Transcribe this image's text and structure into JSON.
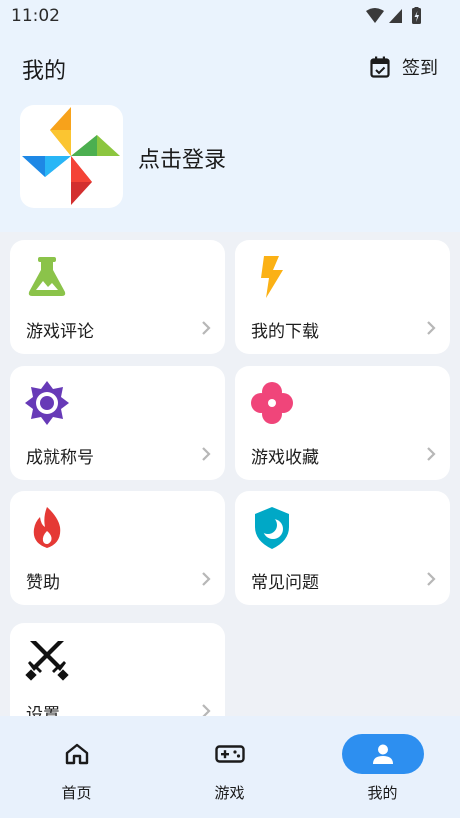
{
  "status_bar": {
    "time": "11:02"
  },
  "header": {
    "title": "我的",
    "checkin_label": "签到"
  },
  "profile": {
    "login_prompt": "点击登录"
  },
  "menu": {
    "game_reviews": "游戏评论",
    "my_downloads": "我的下载",
    "achievements": "成就称号",
    "game_favorites": "游戏收藏",
    "sponsor": "赞助",
    "faq": "常见问题",
    "settings": "设置"
  },
  "bottom_nav": {
    "home": "首页",
    "games": "游戏",
    "mine": "我的"
  },
  "colors": {
    "accent": "#2d8ff0",
    "header_bg": "#eaf3fd",
    "page_bg": "#eef1f6"
  }
}
